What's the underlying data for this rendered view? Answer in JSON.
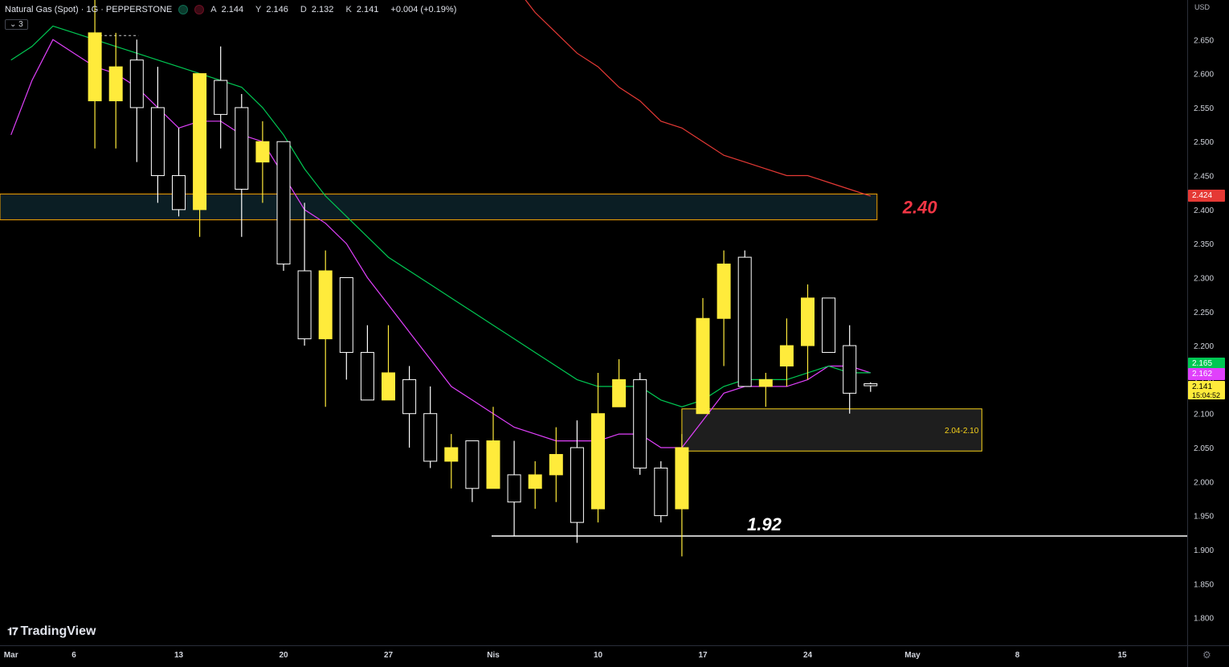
{
  "header": {
    "symbol": "Natural Gas (Spot) · 1G · PEPPERSTONE",
    "ohlc": [
      {
        "k": "A",
        "v": "2.144"
      },
      {
        "k": "Y",
        "v": "2.146"
      },
      {
        "k": "D",
        "v": "2.132"
      },
      {
        "k": "K",
        "v": "2.141"
      }
    ],
    "change": "+0.004 (+0.19%)",
    "indicator_count": "3",
    "currency": "USD"
  },
  "brand": "TradingView",
  "colors": {
    "background": "#000000",
    "bull_body": "#ffeb3b",
    "bear_body": "#000000",
    "candle_outline": "#ffffff",
    "ema_fast": "#e040fb",
    "ema_mid": "#00c853",
    "ema_slow": "#e53935",
    "zone_upper_fill": "#0b1e24",
    "zone_upper_border": "#f7a400",
    "zone_lower_fill": "#1e1e1e",
    "zone_lower_border": "#f7d21b",
    "support_line": "#ffffff",
    "annotation_red": "#f23645"
  },
  "chart_data": {
    "type": "candlestick",
    "timeframe": "1D",
    "ylim": [
      1.76,
      2.72
    ],
    "y_ticks": [
      "2.650",
      "2.600",
      "2.550",
      "2.500",
      "2.450",
      "2.400",
      "2.350",
      "2.300",
      "2.250",
      "2.200",
      "2.150",
      "2.100",
      "2.050",
      "2.000",
      "1.950",
      "1.900",
      "1.850",
      "1.800"
    ],
    "x_ticks": [
      {
        "label": "Mar",
        "idx": -4
      },
      {
        "label": "6",
        "idx": -1
      },
      {
        "label": "13",
        "idx": 4
      },
      {
        "label": "20",
        "idx": 9
      },
      {
        "label": "27",
        "idx": 14
      },
      {
        "label": "Nis",
        "idx": 19
      },
      {
        "label": "10",
        "idx": 24
      },
      {
        "label": "17",
        "idx": 29
      },
      {
        "label": "24",
        "idx": 34
      },
      {
        "label": "May",
        "idx": 39
      },
      {
        "label": "8",
        "idx": 44
      },
      {
        "label": "15",
        "idx": 49
      }
    ],
    "candles": [
      {
        "o": 2.56,
        "h": 2.72,
        "l": 2.49,
        "c": 2.66
      },
      {
        "o": 2.56,
        "h": 2.66,
        "l": 2.49,
        "c": 2.61
      },
      {
        "o": 2.62,
        "h": 2.65,
        "l": 2.47,
        "c": 2.55
      },
      {
        "o": 2.55,
        "h": 2.61,
        "l": 2.41,
        "c": 2.45
      },
      {
        "o": 2.45,
        "h": 2.52,
        "l": 2.39,
        "c": 2.4
      },
      {
        "o": 2.4,
        "h": 2.6,
        "l": 2.36,
        "c": 2.6
      },
      {
        "o": 2.59,
        "h": 2.64,
        "l": 2.49,
        "c": 2.54
      },
      {
        "o": 2.55,
        "h": 2.57,
        "l": 2.36,
        "c": 2.43
      },
      {
        "o": 2.47,
        "h": 2.53,
        "l": 2.41,
        "c": 2.5
      },
      {
        "o": 2.5,
        "h": 2.5,
        "l": 2.31,
        "c": 2.32
      },
      {
        "o": 2.31,
        "h": 2.41,
        "l": 2.2,
        "c": 2.21
      },
      {
        "o": 2.21,
        "h": 2.34,
        "l": 2.11,
        "c": 2.31
      },
      {
        "o": 2.3,
        "h": 2.3,
        "l": 2.15,
        "c": 2.19
      },
      {
        "o": 2.19,
        "h": 2.23,
        "l": 2.12,
        "c": 2.12
      },
      {
        "o": 2.12,
        "h": 2.23,
        "l": 2.12,
        "c": 2.16
      },
      {
        "o": 2.15,
        "h": 2.17,
        "l": 2.05,
        "c": 2.1
      },
      {
        "o": 2.1,
        "h": 2.14,
        "l": 2.02,
        "c": 2.03
      },
      {
        "o": 2.03,
        "h": 2.07,
        "l": 1.99,
        "c": 2.05
      },
      {
        "o": 2.06,
        "h": 2.06,
        "l": 1.97,
        "c": 1.99
      },
      {
        "o": 1.99,
        "h": 2.11,
        "l": 1.99,
        "c": 2.06
      },
      {
        "o": 2.01,
        "h": 2.06,
        "l": 1.92,
        "c": 1.97
      },
      {
        "o": 1.99,
        "h": 2.03,
        "l": 1.96,
        "c": 2.01
      },
      {
        "o": 2.01,
        "h": 2.08,
        "l": 1.97,
        "c": 2.04
      },
      {
        "o": 2.05,
        "h": 2.09,
        "l": 1.91,
        "c": 1.94
      },
      {
        "o": 1.96,
        "h": 2.16,
        "l": 1.94,
        "c": 2.1
      },
      {
        "o": 2.11,
        "h": 2.18,
        "l": 2.11,
        "c": 2.15
      },
      {
        "o": 2.15,
        "h": 2.16,
        "l": 2.01,
        "c": 2.02
      },
      {
        "o": 2.02,
        "h": 2.03,
        "l": 1.94,
        "c": 1.95
      },
      {
        "o": 1.96,
        "h": 2.07,
        "l": 1.89,
        "c": 2.05
      },
      {
        "o": 2.1,
        "h": 2.27,
        "l": 2.1,
        "c": 2.24
      },
      {
        "o": 2.24,
        "h": 2.34,
        "l": 2.17,
        "c": 2.32
      },
      {
        "o": 2.33,
        "h": 2.34,
        "l": 2.14,
        "c": 2.14
      },
      {
        "o": 2.14,
        "h": 2.16,
        "l": 2.11,
        "c": 2.15
      },
      {
        "o": 2.17,
        "h": 2.24,
        "l": 2.14,
        "c": 2.2
      },
      {
        "o": 2.2,
        "h": 2.29,
        "l": 2.15,
        "c": 2.27
      },
      {
        "o": 2.27,
        "h": 2.27,
        "l": 2.19,
        "c": 2.19
      },
      {
        "o": 2.2,
        "h": 2.23,
        "l": 2.1,
        "c": 2.13
      },
      {
        "o": 2.144,
        "h": 2.146,
        "l": 2.132,
        "c": 2.141
      }
    ],
    "moving_averages": [
      {
        "color": "#e040fb",
        "points": [
          [
            -4,
            2.51
          ],
          [
            -3,
            2.59
          ],
          [
            -2,
            2.65
          ],
          [
            -1,
            2.63
          ],
          [
            0,
            2.61
          ],
          [
            1,
            2.6
          ],
          [
            2,
            2.58
          ],
          [
            3,
            2.55
          ],
          [
            4,
            2.52
          ],
          [
            5,
            2.53
          ],
          [
            6,
            2.53
          ],
          [
            7,
            2.51
          ],
          [
            8,
            2.5
          ],
          [
            9,
            2.45
          ],
          [
            10,
            2.4
          ],
          [
            11,
            2.38
          ],
          [
            12,
            2.35
          ],
          [
            13,
            2.3
          ],
          [
            14,
            2.26
          ],
          [
            15,
            2.22
          ],
          [
            16,
            2.18
          ],
          [
            17,
            2.14
          ],
          [
            18,
            2.12
          ],
          [
            19,
            2.1
          ],
          [
            20,
            2.08
          ],
          [
            21,
            2.07
          ],
          [
            22,
            2.06
          ],
          [
            23,
            2.06
          ],
          [
            24,
            2.06
          ],
          [
            25,
            2.07
          ],
          [
            26,
            2.07
          ],
          [
            27,
            2.05
          ],
          [
            28,
            2.05
          ],
          [
            29,
            2.09
          ],
          [
            30,
            2.13
          ],
          [
            31,
            2.14
          ],
          [
            32,
            2.14
          ],
          [
            33,
            2.14
          ],
          [
            34,
            2.15
          ],
          [
            35,
            2.17
          ],
          [
            36,
            2.17
          ],
          [
            37,
            2.16
          ]
        ]
      },
      {
        "color": "#00c853",
        "points": [
          [
            -4,
            2.62
          ],
          [
            -3,
            2.64
          ],
          [
            -2,
            2.67
          ],
          [
            -1,
            2.66
          ],
          [
            0,
            2.65
          ],
          [
            1,
            2.64
          ],
          [
            2,
            2.63
          ],
          [
            3,
            2.62
          ],
          [
            4,
            2.61
          ],
          [
            5,
            2.6
          ],
          [
            6,
            2.59
          ],
          [
            7,
            2.58
          ],
          [
            8,
            2.55
          ],
          [
            9,
            2.51
          ],
          [
            10,
            2.46
          ],
          [
            11,
            2.42
          ],
          [
            12,
            2.39
          ],
          [
            13,
            2.36
          ],
          [
            14,
            2.33
          ],
          [
            15,
            2.31
          ],
          [
            16,
            2.29
          ],
          [
            17,
            2.27
          ],
          [
            18,
            2.25
          ],
          [
            19,
            2.23
          ],
          [
            20,
            2.21
          ],
          [
            21,
            2.19
          ],
          [
            22,
            2.17
          ],
          [
            23,
            2.15
          ],
          [
            24,
            2.14
          ],
          [
            25,
            2.14
          ],
          [
            26,
            2.14
          ],
          [
            27,
            2.12
          ],
          [
            28,
            2.11
          ],
          [
            29,
            2.12
          ],
          [
            30,
            2.14
          ],
          [
            31,
            2.15
          ],
          [
            32,
            2.15
          ],
          [
            33,
            2.15
          ],
          [
            34,
            2.16
          ],
          [
            35,
            2.17
          ],
          [
            36,
            2.16
          ],
          [
            37,
            2.16
          ]
        ]
      },
      {
        "color": "#e53935",
        "points": [
          [
            20,
            2.73
          ],
          [
            21,
            2.69
          ],
          [
            22,
            2.66
          ],
          [
            23,
            2.63
          ],
          [
            24,
            2.61
          ],
          [
            25,
            2.58
          ],
          [
            26,
            2.56
          ],
          [
            27,
            2.53
          ],
          [
            28,
            2.52
          ],
          [
            29,
            2.5
          ],
          [
            30,
            2.48
          ],
          [
            31,
            2.47
          ],
          [
            32,
            2.46
          ],
          [
            33,
            2.45
          ],
          [
            34,
            2.45
          ],
          [
            35,
            2.44
          ],
          [
            36,
            2.43
          ],
          [
            37,
            2.42
          ]
        ]
      }
    ],
    "zones": [
      {
        "from_idx": -5,
        "to_idx": 37,
        "y1": 2.385,
        "y2": 2.423,
        "kind": "upper",
        "annotation": "2.40"
      },
      {
        "from_idx": 28,
        "to_idx": 42,
        "y1": 2.045,
        "y2": 2.107,
        "kind": "lower",
        "label": "2.04-2.10"
      }
    ],
    "support": {
      "from_idx": 19,
      "y": 1.92,
      "annotation": "1.92"
    },
    "dashed_marker": {
      "from_idx": 0,
      "to_idx": 2,
      "y": 2.656
    },
    "price_labels": [
      {
        "value": "2.424",
        "color": "#e53935"
      },
      {
        "value": "2.165",
        "color": "#00c853"
      },
      {
        "value": "2.162",
        "color": "#e040fb"
      },
      {
        "value": "2.141",
        "color": "#ffeb3b",
        "sub": "15:04:52"
      }
    ]
  }
}
